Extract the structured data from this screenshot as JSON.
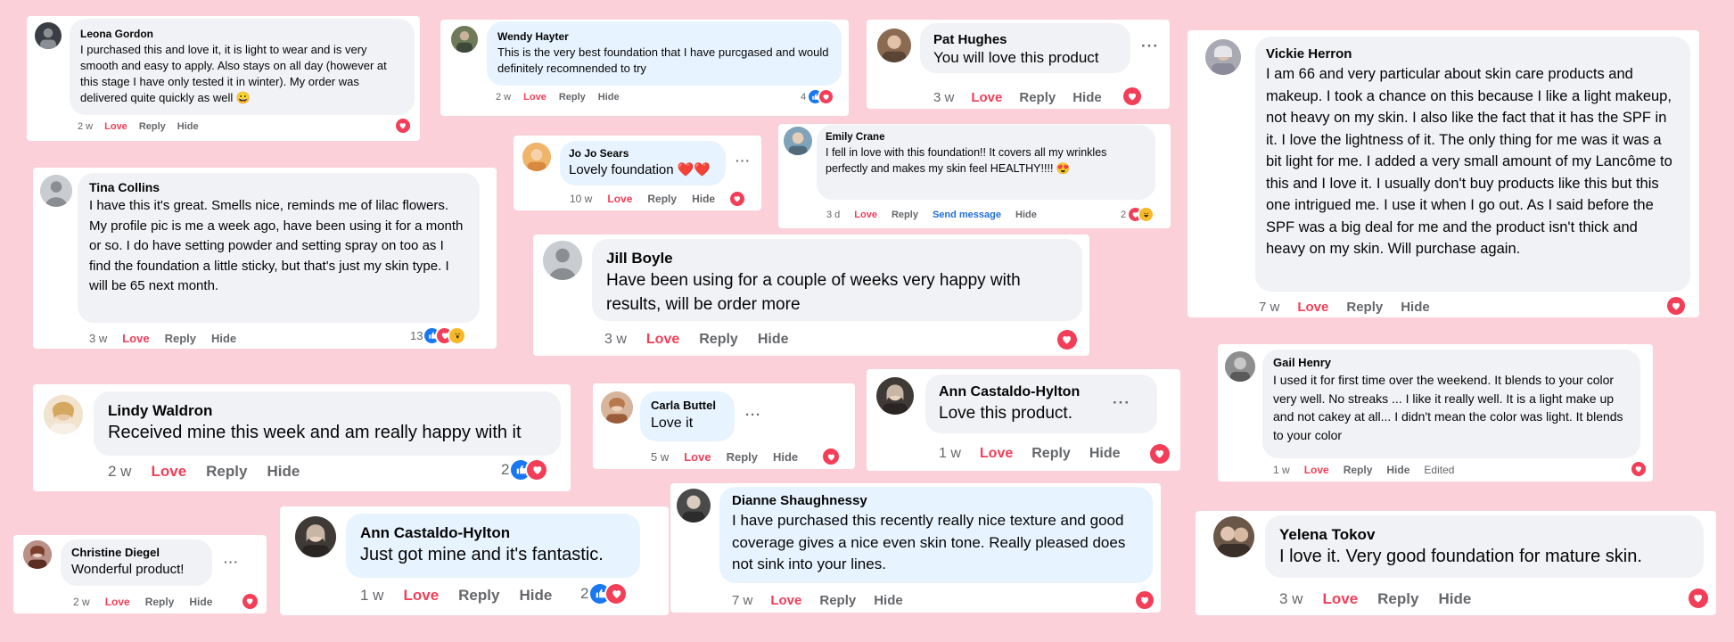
{
  "colors": {
    "background": "#fbd0d9",
    "love": "#f33e58",
    "like": "#1877f2",
    "bubble": "#f0f2f5",
    "bubble_active": "#e7f3ff",
    "send_message": "#216fdb"
  },
  "labels": {
    "love": "Love",
    "reply": "Reply",
    "hide": "Hide",
    "send_message": "Send message",
    "edited": "Edited",
    "more": "···"
  },
  "comments": [
    {
      "name": "Leona Gordon",
      "text": "I purchased this and love it, it is light to wear and is very smooth and easy to apply. Also stays on all day (however at this stage I have only tested it in winter). My order was delivered quite quickly as well 😀",
      "time": "2 w"
    },
    {
      "name": "Wendy Hayter",
      "text": "This is the very best foundation that I have purcgased and would definitely recomnended to try",
      "time": "2 w",
      "reactions": "4"
    },
    {
      "name": "Pat Hughes",
      "text": "You will love this product",
      "time": "3 w"
    },
    {
      "name": "Vickie Herron",
      "text": "I am 66 and very particular about skin care products and makeup. I took a chance on this because I like a light makeup, not heavy on my skin. I also like the fact that it has the SPF in it. I love the lightness of it. The only thing for me was it was a bit light for me. I added a very small amount of my Lancôme to this and I love it. I usually don't buy products like this but this one intrigued me. I use it when I go out. As I said before the SPF was a big deal for me and the product isn't thick and heavy on my skin. Will purchase again.",
      "time": "7 w"
    },
    {
      "name": "Jo Jo Sears",
      "text": "Lovely foundation ❤️❤️",
      "time": "10 w"
    },
    {
      "name": "Emily Crane",
      "text": "I fell in love with this foundation!! It covers all my wrinkles perfectly and makes my skin feel HEALTHY!!!! 😍",
      "time": "3 d",
      "reactions": "2"
    },
    {
      "name": "Tina Collins",
      "text": "I have this it's great. Smells nice, reminds me of lilac flowers. My profile pic is me a week ago, have been using it for a month or so. I do have setting powder and setting spray on too as I find the foundation a little sticky, but that's just my skin type. I will be 65 next month.",
      "time": "3 w",
      "reactions": "13"
    },
    {
      "name": "Jill Boyle",
      "text": "Have been using for a couple of weeks very happy with results, will be order more",
      "time": "3 w"
    },
    {
      "name": "Gail Henry",
      "text": "I used it for first time over the weekend. It blends to your color very well. No streaks ... I like it really well. It is a light make up and not cakey at all... I didn't mean the color was light. It blends to your color",
      "time": "1 w"
    },
    {
      "name": "Lindy Waldron",
      "text": "Received mine this week and am really happy with it",
      "time": "2 w",
      "reactions": "2"
    },
    {
      "name": "Carla Buttel",
      "text": "Love it",
      "time": "5 w"
    },
    {
      "name": "Ann Castaldo-Hylton",
      "text": "Love this product.",
      "time": "1 w"
    },
    {
      "name": "Dianne Shaughnessy",
      "text": "I have purchased this recently really nice texture and good coverage gives a nice even skin tone. Really pleased does not sink into your lines.",
      "time": "7 w"
    },
    {
      "name": "Yelena Tokov",
      "text": "I love it. Very good foundation for mature skin.",
      "time": "3 w"
    },
    {
      "name": "Christine Diegel",
      "text": "Wonderful product!",
      "time": "2 w"
    },
    {
      "name": "Ann Castaldo-Hylton",
      "text": "Just got mine and it's fantastic.",
      "time": "1 w",
      "reactions": "2"
    }
  ]
}
